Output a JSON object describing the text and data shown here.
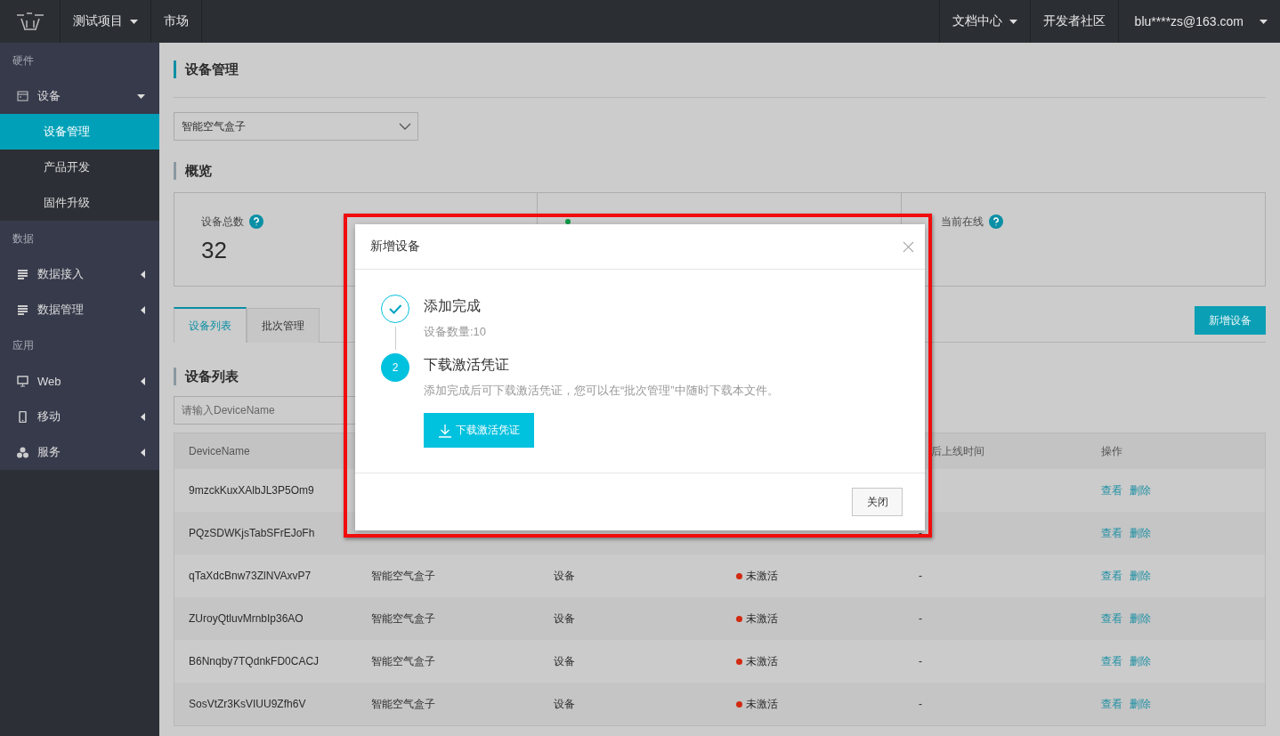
{
  "topbar": {
    "nav": [
      {
        "label": "测试项目",
        "dropdown": true
      },
      {
        "label": "市场",
        "dropdown": false
      }
    ],
    "right": [
      {
        "label": "文档中心",
        "dropdown": true
      },
      {
        "label": "开发者社区",
        "dropdown": false
      },
      {
        "label": "blu****zs@163.com",
        "dropdown": true
      }
    ]
  },
  "sidebar": [
    {
      "kind": "heading",
      "label": "硬件"
    },
    {
      "kind": "item",
      "label": "设备",
      "expanded": true,
      "children": [
        {
          "label": "设备管理",
          "selected": true
        },
        {
          "label": "产品开发",
          "selected": false
        },
        {
          "label": "固件升级",
          "selected": false
        }
      ]
    },
    {
      "kind": "heading",
      "label": "数据"
    },
    {
      "kind": "item",
      "label": "数据接入",
      "expanded": false
    },
    {
      "kind": "item",
      "label": "数据管理",
      "expanded": false
    },
    {
      "kind": "heading",
      "label": "应用"
    },
    {
      "kind": "item",
      "label": "Web",
      "expanded": false
    },
    {
      "kind": "item",
      "label": "移动",
      "expanded": false
    },
    {
      "kind": "item",
      "label": "服务",
      "expanded": false
    }
  ],
  "page": {
    "title": "设备管理",
    "product_select": {
      "value": "智能空气盒子"
    },
    "overview": {
      "title": "概览",
      "stats": [
        {
          "label": "设备总数",
          "value": "32",
          "dot": false
        },
        {
          "dot": true
        },
        {
          "label": "当前在线",
          "dot": false
        }
      ]
    },
    "tabs": [
      {
        "label": "设备列表",
        "selected": true
      },
      {
        "label": "批次管理",
        "selected": false
      }
    ],
    "add_button": "新增设备",
    "list_title": "设备列表",
    "search": {
      "placeholder": "请输入DeviceName"
    },
    "table": {
      "columns": {
        "device_name": "DeviceName",
        "last_online": "后上线时间",
        "actions": "操作"
      },
      "rows": [
        {
          "device_name": "9mzckKuxXAlbJL3P5Om9",
          "actions": [
            "查看",
            "删除"
          ]
        },
        {
          "device_name": "PQzSDWKjsTabSFrEJoFh",
          "last_online": "-",
          "actions": [
            "查看",
            "删除"
          ]
        },
        {
          "device_name": "qTaXdcBnw73ZlNVAxvP7",
          "product": "智能空气盒子",
          "node_type": "设备",
          "status": "未激活",
          "active": false,
          "last_online": "-",
          "actions": [
            "查看",
            "删除"
          ]
        },
        {
          "device_name": "ZUroyQtluvMrnbIp36AO",
          "product": "智能空气盒子",
          "node_type": "设备",
          "status": "未激活",
          "active": false,
          "last_online": "-",
          "actions": [
            "查看",
            "删除"
          ]
        },
        {
          "device_name": "B6Nnqby7TQdnkFD0CACJ",
          "product": "智能空气盒子",
          "node_type": "设备",
          "status": "未激活",
          "active": false,
          "last_online": "-",
          "actions": [
            "查看",
            "删除"
          ]
        },
        {
          "device_name": "SosVtZr3KsVIUU9Zfh6V",
          "product": "智能空气盒子",
          "node_type": "设备",
          "status": "未激活",
          "active": false,
          "last_online": "-",
          "actions": [
            "查看",
            "删除"
          ]
        }
      ]
    }
  },
  "dialog": {
    "title": "新增设备",
    "steps": [
      {
        "kind": "done",
        "title": "添加完成",
        "detail": "设备数量:10"
      },
      {
        "kind": "current",
        "number": "2",
        "title": "下载激活凭证",
        "detail": "添加完成后可下载激活凭证，您可以在“批次管理”中随时下载本文件。",
        "button": "下载激活凭证"
      }
    ],
    "close_button": "关闭"
  }
}
